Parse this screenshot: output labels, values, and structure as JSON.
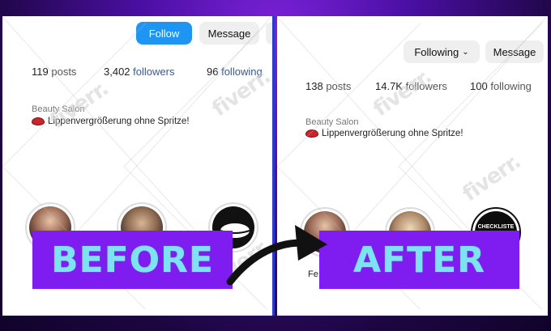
{
  "before": {
    "follow_label": "Follow",
    "message_label": "Message",
    "stats": {
      "posts": "119",
      "posts_label": "posts",
      "followers": "3,402",
      "followers_label": "followers",
      "following": "96",
      "following_label": "following"
    },
    "category": "Beauty Salon",
    "bio": "Lippenvergrößerung ohne Spritze!",
    "banner": "BEFORE"
  },
  "after": {
    "following_label": "Following",
    "message_label": "Message",
    "stats": {
      "posts": "138",
      "posts_label": "posts",
      "followers": "14.7K",
      "followers_label": "followers",
      "following": "100",
      "following_label": "following"
    },
    "category": "Beauty Salon",
    "bio": "Lippenvergrößerung ohne Spritze!",
    "highlight_text": "CHECKLISTE",
    "partial_label": "Fe",
    "banner": "AFTER"
  },
  "watermark": "fiverr.",
  "colors": {
    "follow_blue": "#1e95f5",
    "banner_purple": "#7f1cf0",
    "banner_text": "#7de3f2"
  }
}
